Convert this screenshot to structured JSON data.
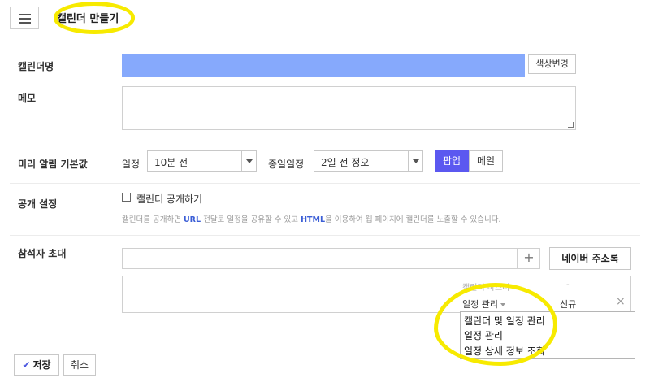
{
  "header": {
    "title": "캘린더 만들기"
  },
  "form": {
    "name_label": "캘린더명",
    "name_value": "",
    "color_button": "색상변경",
    "memo_label": "메모",
    "memo_value": "",
    "alarm": {
      "label": "미리 알림 기본값",
      "schedule_label": "일정",
      "schedule_value": "10분 전",
      "allday_label": "종일일정",
      "allday_value": "2일 전 정오",
      "popup_button": "팝업",
      "mail_button": "메일"
    },
    "public": {
      "label": "공개 설정",
      "checkbox_label": "캘린더 공개하기",
      "checked": false,
      "desc_1": "캘린더를 공개하면 ",
      "desc_url": "URL",
      "desc_2": " 전달로 일정을 공유할 수 있고 ",
      "desc_html": "HTML",
      "desc_3": "을 이용하여 웹 페이지에 캘린더를 노출할 수 있습니다."
    },
    "invite": {
      "label": "참석자 초대",
      "input_value": "",
      "plus": "+",
      "address_button": "네이버 주소록",
      "row": {
        "role": "캘린더 마스터",
        "role_dash": "-",
        "permission": "일정 관리",
        "status": "신규",
        "remove": "×"
      },
      "permission_options": [
        "캘린더 및 일정 관리",
        "일정 관리",
        "일정 상세 정보 조회"
      ]
    }
  },
  "footer": {
    "save_button": "저장",
    "cancel_button": "취소"
  },
  "colors": {
    "name_field": "#86a9fc",
    "accent": "#5b58f0",
    "link": "#3b5ed6",
    "highlight": "#f7ea00"
  },
  "icons": {
    "menu": "hamburger-icon",
    "save_check": "check-icon",
    "dropdown": "caret-down-icon",
    "remove": "close-icon"
  }
}
